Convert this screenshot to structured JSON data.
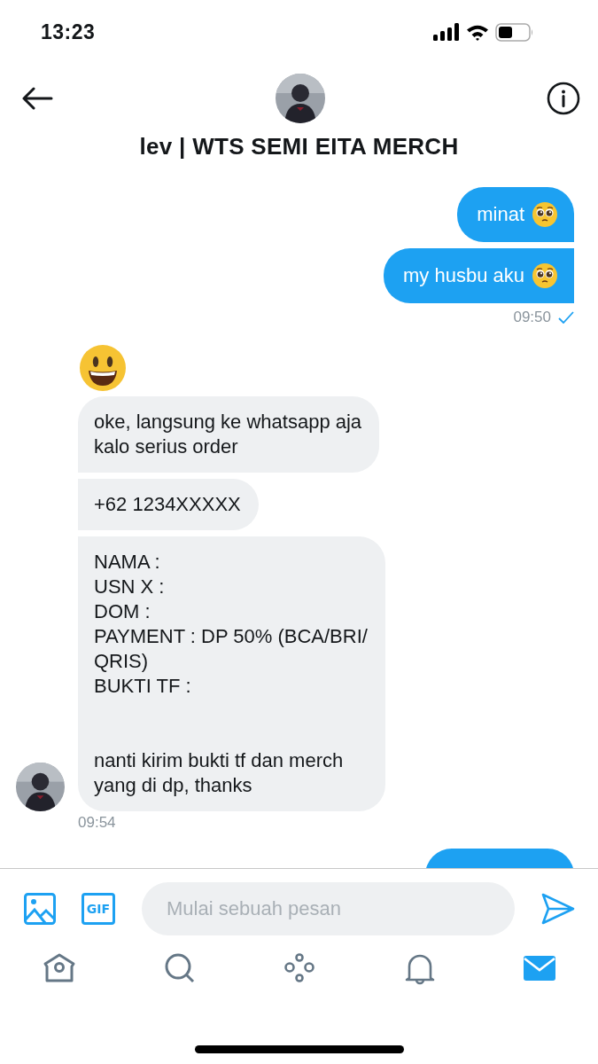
{
  "status_bar": {
    "time": "13:23"
  },
  "header": {
    "title": "lev | WTS SEMI EITA MERCH"
  },
  "messages": [
    {
      "outgoing": true,
      "kind": "text",
      "text": "minat",
      "emoji": true
    },
    {
      "outgoing": true,
      "kind": "text",
      "text": "my husbu aku",
      "emoji": true
    },
    {
      "outgoing": true,
      "kind": "time",
      "text": "09:50",
      "read": true
    },
    {
      "kind": "emoji"
    },
    {
      "outgoing": false,
      "kind": "text",
      "text": "oke, langsung ke whatsapp aja\nkalo serius order"
    },
    {
      "outgoing": false,
      "kind": "text",
      "text": "+62 1234XXXXX"
    },
    {
      "outgoing": false,
      "kind": "text",
      "text": "NAMA :\nUSN X :\nDOM :\nPAYMENT : DP 50% (BCA/BRI/\nQRIS)\nBUKTI TF :\n\n\nnanti kirim bukti tf dan merch\nyang di dp, thanks",
      "avatar": true
    },
    {
      "outgoing": false,
      "kind": "time",
      "text": "09:54"
    },
    {
      "outgoing": true,
      "kind": "partial"
    }
  ],
  "composer": {
    "gif_label": "GIF",
    "placeholder": "Mulai sebuah pesan"
  },
  "tabs": [
    {
      "kind": "home",
      "selected": false
    },
    {
      "kind": "search",
      "selected": false
    },
    {
      "kind": "spaces",
      "selected": false
    },
    {
      "kind": "notifications",
      "selected": false
    },
    {
      "kind": "messages",
      "selected": true
    }
  ]
}
